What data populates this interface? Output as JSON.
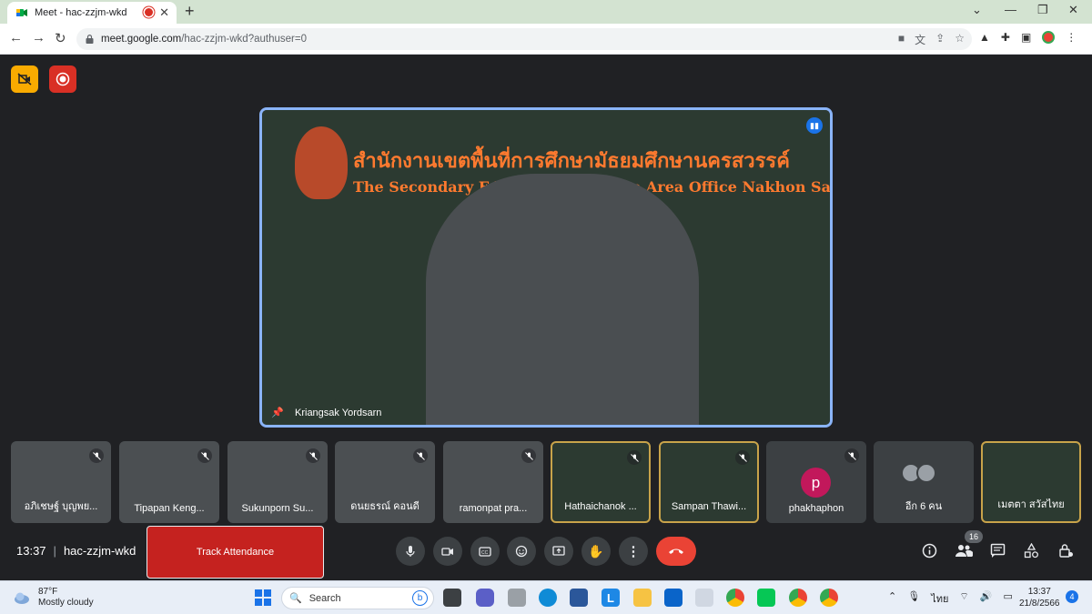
{
  "browser": {
    "tab_title": "Meet - hac-zzjm-wkd",
    "url_host": "meet.google.com",
    "url_path": "/hac-zzjm-wkd?authuser=0"
  },
  "speaker": {
    "name": "Kriangsak Yordsarn",
    "banner_th": "สำนักงานเขตพื้นที่การศึกษามัธยมศึกษานครสวรรค์",
    "banner_en": "The Secondary Educational Service Area Office Nakhon Sawan"
  },
  "participants": [
    {
      "name": "อภิเชษฐ์ บุญพย...",
      "muted": true
    },
    {
      "name": "Tipapan Keng...",
      "muted": true
    },
    {
      "name": "Sukunporn Su...",
      "muted": true
    },
    {
      "name": "ดนยธรณ์ คอนดี",
      "muted": true
    },
    {
      "name": "ramonpat pra...",
      "muted": true
    },
    {
      "name": "Hathaichanok ...",
      "muted": true
    },
    {
      "name": "Sampan Thawi...",
      "muted": true
    },
    {
      "name": "phakhaphon",
      "muted": true,
      "avatar_letter": "p"
    },
    {
      "name": "อีก 6 คน"
    },
    {
      "name": "เมตตา สวัสไทย"
    }
  ],
  "bottom_bar": {
    "time": "13:37",
    "meeting_code": "hac-zzjm-wkd",
    "track_attendance": "Track Attendance",
    "people_count": "16"
  },
  "taskbar": {
    "temperature": "87°F",
    "weather": "Mostly cloudy",
    "search_placeholder": "Search",
    "language": "ไทย",
    "time": "13:37",
    "date": "21/8/2566",
    "notification_count": "4"
  },
  "colors": {
    "meet_bg": "#202124",
    "accent_blue": "#8ab4f8",
    "end_call_red": "#ea4335",
    "track_red": "#c5221f"
  }
}
